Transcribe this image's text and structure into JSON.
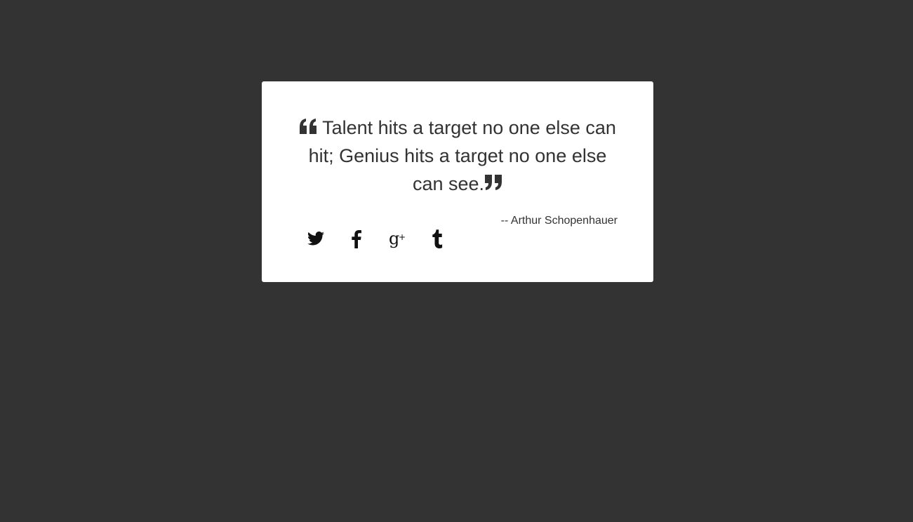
{
  "quote": {
    "text": "Talent hits a target no one else can hit; Genius hits a target no one else can see.",
    "author": "-- Arthur Schopenhauer",
    "open_icon": "quote-left-icon",
    "close_icon": "quote-right-icon"
  },
  "share": {
    "items": [
      {
        "icon": "twitter-icon"
      },
      {
        "icon": "facebook-icon"
      },
      {
        "icon": "google-plus-icon"
      },
      {
        "icon": "tumblr-icon"
      }
    ]
  },
  "colors": {
    "background": "#333333",
    "card": "#ffffff",
    "text": "#333333",
    "icon": "#111111"
  }
}
